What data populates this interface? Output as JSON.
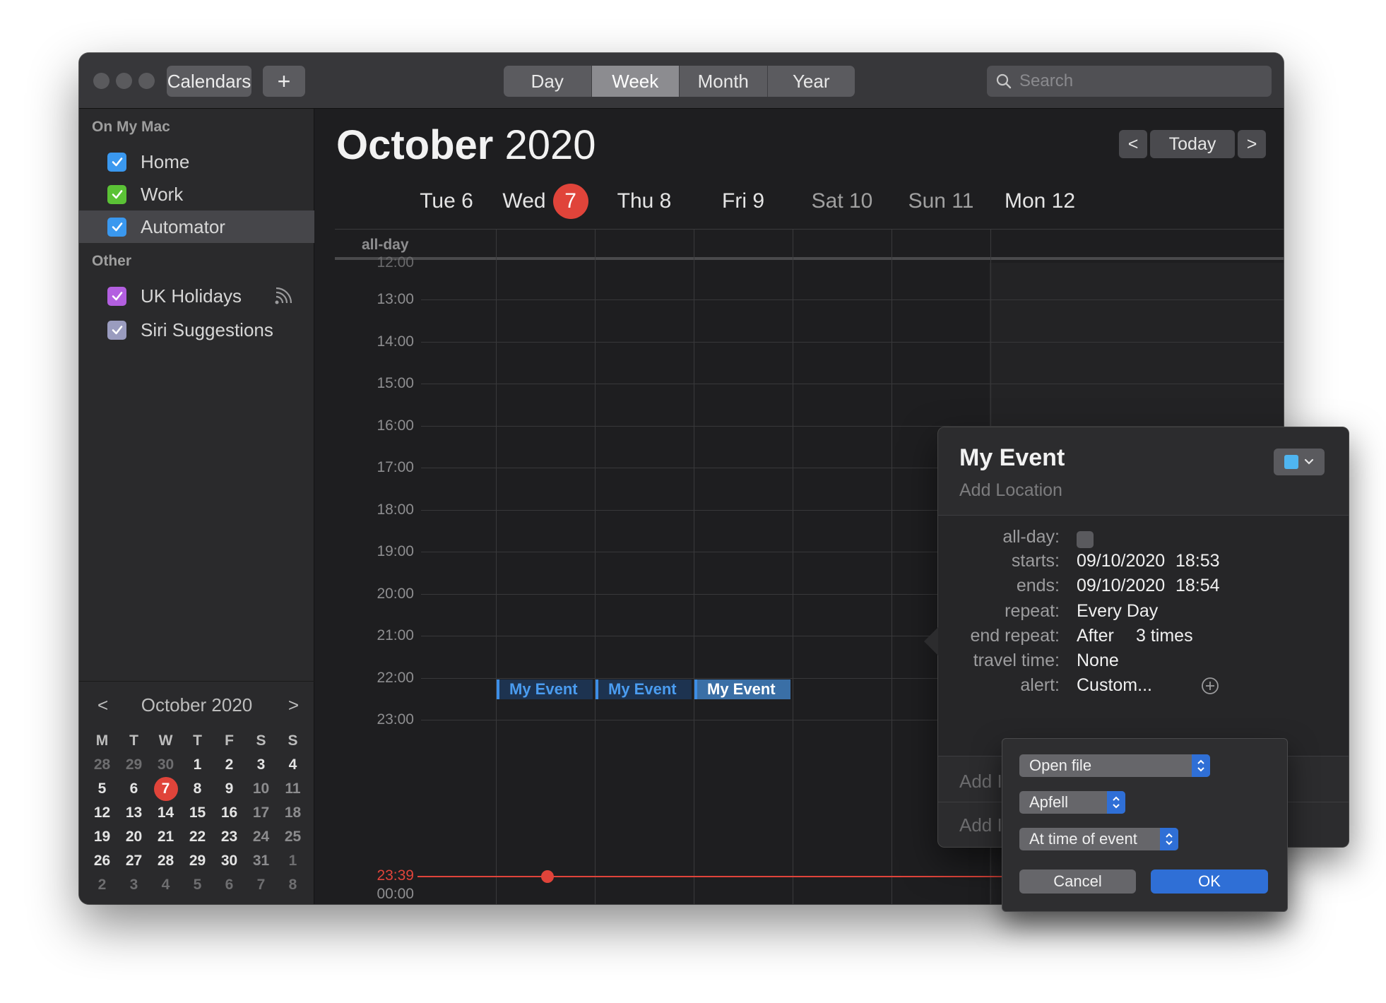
{
  "toolbar": {
    "calendars_label": "Calendars",
    "add_label": "+",
    "views": [
      "Day",
      "Week",
      "Month",
      "Year"
    ],
    "active_view": "Week",
    "search_placeholder": "Search"
  },
  "sidebar": {
    "section_mac": "On My Mac",
    "mac_calendars": [
      {
        "name": "Home",
        "color": "#3a98ef",
        "selected": false
      },
      {
        "name": "Work",
        "color": "#5bc236",
        "selected": false
      },
      {
        "name": "Automator",
        "color": "#3a98ef",
        "selected": true
      }
    ],
    "section_other": "Other",
    "other_calendars": [
      {
        "name": "UK Holidays",
        "color": "#b35fe0",
        "feed_icon": "subscription-icon"
      },
      {
        "name": "Siri Suggestions",
        "color": "#9a9cbf"
      }
    ]
  },
  "mini_calendar": {
    "title": "October 2020",
    "prev": "<",
    "next": ">",
    "weekdays": [
      "M",
      "T",
      "W",
      "T",
      "F",
      "S",
      "S"
    ],
    "weeks": [
      [
        "28",
        "29",
        "30",
        "1",
        "2",
        "3",
        "4"
      ],
      [
        "5",
        "6",
        "7",
        "8",
        "9",
        "10",
        "11"
      ],
      [
        "12",
        "13",
        "14",
        "15",
        "16",
        "17",
        "18"
      ],
      [
        "19",
        "20",
        "21",
        "22",
        "23",
        "24",
        "25"
      ],
      [
        "26",
        "27",
        "28",
        "29",
        "30",
        "31",
        "1"
      ],
      [
        "2",
        "3",
        "4",
        "5",
        "6",
        "7",
        "8"
      ]
    ],
    "today": "7"
  },
  "main": {
    "month": "October",
    "year": "2020",
    "prev": "<",
    "today_label": "Today",
    "next": ">",
    "days": [
      {
        "label": "Tue 6"
      },
      {
        "label": "Wed",
        "badge": "7"
      },
      {
        "label": "Thu 8"
      },
      {
        "label": "Fri 9"
      },
      {
        "label": "Sat 10"
      },
      {
        "label": "Sun 11"
      },
      {
        "label": "Mon 12"
      }
    ],
    "allday_label": "all-day",
    "top_partial_hour": "12:00",
    "hours": [
      "13:00",
      "14:00",
      "15:00",
      "16:00",
      "17:00",
      "18:00",
      "19:00",
      "20:00",
      "21:00",
      "22:00",
      "23:00"
    ],
    "bottom_hour": "00:00",
    "now_time": "23:39",
    "events": [
      {
        "title": "My Event",
        "day": "Wed 7"
      },
      {
        "title": "My Event",
        "day": "Thu 8"
      },
      {
        "title": "My Event",
        "day": "Fri 9",
        "selected": true
      }
    ]
  },
  "popover": {
    "title": "My Event",
    "location_placeholder": "Add Location",
    "color": "#4fb5f0",
    "fields": {
      "allday_label": "all-day:",
      "starts_label": "starts:",
      "starts_date": "09/10/2020",
      "starts_time": "18:53",
      "ends_label": "ends:",
      "ends_date": "09/10/2020",
      "ends_time": "18:54",
      "repeat_label": "repeat:",
      "repeat_value": "Every Day",
      "end_repeat_label": "end repeat:",
      "end_repeat_value": "After",
      "end_repeat_count": "3 times",
      "travel_label": "travel time:",
      "travel_value": "None",
      "alert_label": "alert:",
      "alert_value": "Custom..."
    },
    "add_rows": [
      "Add I",
      "Add I"
    ]
  },
  "alert_popover": {
    "action": "Open file",
    "file": "Apfell",
    "timing": "At time of event",
    "cancel_label": "Cancel",
    "ok_label": "OK"
  }
}
